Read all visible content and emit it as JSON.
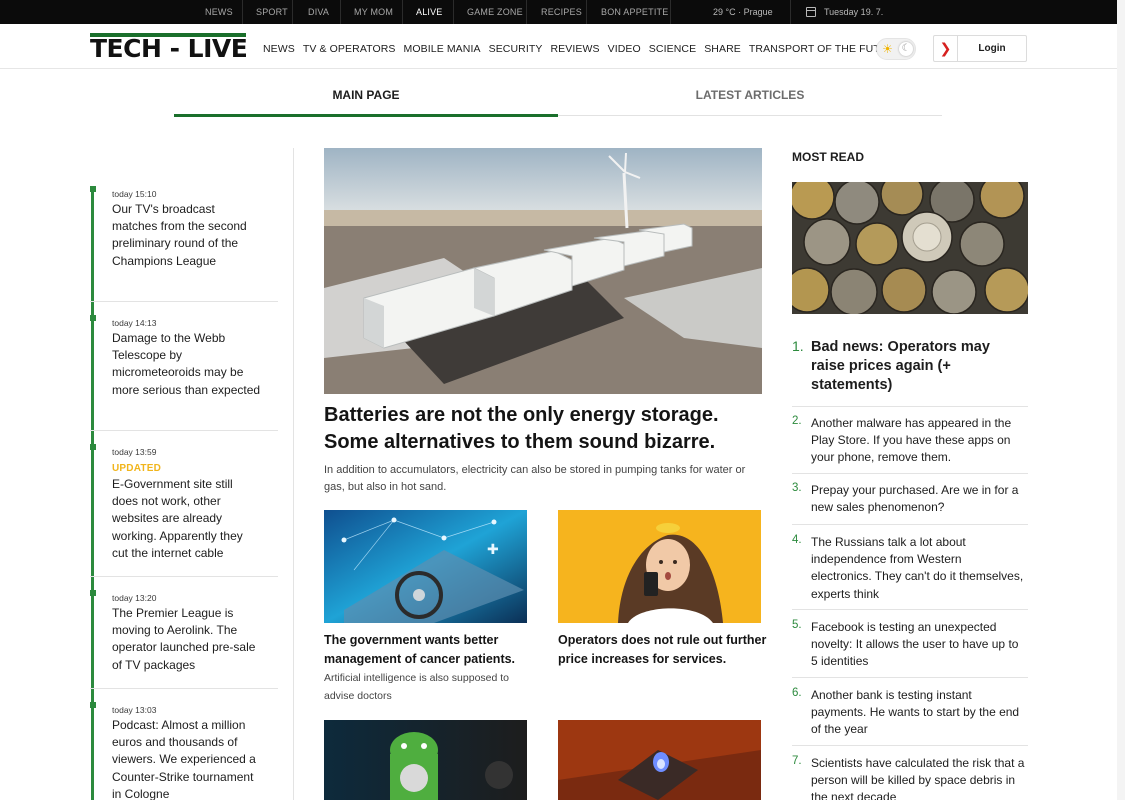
{
  "topbar": {
    "links": [
      {
        "label": "NEWS",
        "active": false
      },
      {
        "label": "SPORT",
        "active": false
      },
      {
        "label": "DIVA",
        "active": false
      },
      {
        "label": "MY MOM",
        "active": false
      },
      {
        "label": "ALIVE",
        "active": true
      },
      {
        "label": "GAME ZONE",
        "active": false
      },
      {
        "label": "RECIPES",
        "active": false
      },
      {
        "label": "BON APPETITE",
        "active": false
      }
    ],
    "weather": "29 °C ·  Prague",
    "date": "Tuesday 19. 7."
  },
  "header": {
    "logo": "TECH - LIVE",
    "nav": [
      "NEWS",
      "TV & OPERATORS",
      "MOBILE MANIA",
      "SECURITY",
      "REVIEWS",
      "VIDEO",
      "SCIENCE",
      "SHARE",
      "TRANSPORT OF THE FUTURE"
    ],
    "login_label": "Login",
    "theme_icons": {
      "light": "sun-icon",
      "dark": "moon-icon"
    }
  },
  "tabs": [
    {
      "label": "MAIN PAGE",
      "active": true
    },
    {
      "label": "LATEST ARTICLES",
      "active": false
    }
  ],
  "timeline": [
    {
      "time": "today 15:10",
      "updated": "",
      "title": "Our TV's broadcast matches from the second preliminary round of the Champions League"
    },
    {
      "time": "today 14:13",
      "updated": "",
      "title": "Damage to the Webb Telescope by micrometeoroids may be more serious than expected"
    },
    {
      "time": "today 13:59",
      "updated": "UPDATED",
      "title": "E-Government site still does not work, other websites are already working. Apparently they cut the internet cable"
    },
    {
      "time": "today 13:20",
      "updated": "",
      "title": "The Premier League is moving to Aerolink. The operator launched pre-sale of TV packages"
    },
    {
      "time": "today 13:03",
      "updated": "",
      "title": "Podcast: Almost a million euros and thousands of viewers. We experienced a Counter-Strike tournament in Cologne"
    }
  ],
  "main_article": {
    "title": "Batteries are not the only energy storage. Some alternatives to them sound bizarre.",
    "perex": "In addition to accumulators, electricity can also be stored in pumping tanks for water or gas, but also in hot sand."
  },
  "cards": [
    {
      "title": "The government wants better management of cancer patients.",
      "perex": "Artificial intelligence is also supposed to advise doctors"
    },
    {
      "title": "Operators does not rule out further price increases for services.",
      "perex": ""
    }
  ],
  "most_read": {
    "heading": "MOST READ",
    "items": [
      {
        "num": "1.",
        "title": "Bad news: Operators may raise prices again (+ statements)"
      },
      {
        "num": "2.",
        "title": "Another malware has appeared in the Play Store. If you have these apps on your phone, remove them."
      },
      {
        "num": "3.",
        "title": "Prepay your purchased. Are we in for a new sales phenomenon?"
      },
      {
        "num": "4.",
        "title": "The Russians talk a lot about independence from Western electronics. They can't do it themselves, experts think"
      },
      {
        "num": "5.",
        "title": "Facebook is testing an unexpected novelty: It allows the user to have up to 5 identities"
      },
      {
        "num": "6.",
        "title": "Another bank is testing instant payments. He wants to start by the end of the year"
      },
      {
        "num": "7.",
        "title": "Scientists have calculated the risk that a person will be killed by space debris in the next decade"
      }
    ]
  },
  "colors": {
    "accent": "#1a6f2b",
    "updated": "#f1b51c",
    "login_chevron": "#d6201f"
  }
}
